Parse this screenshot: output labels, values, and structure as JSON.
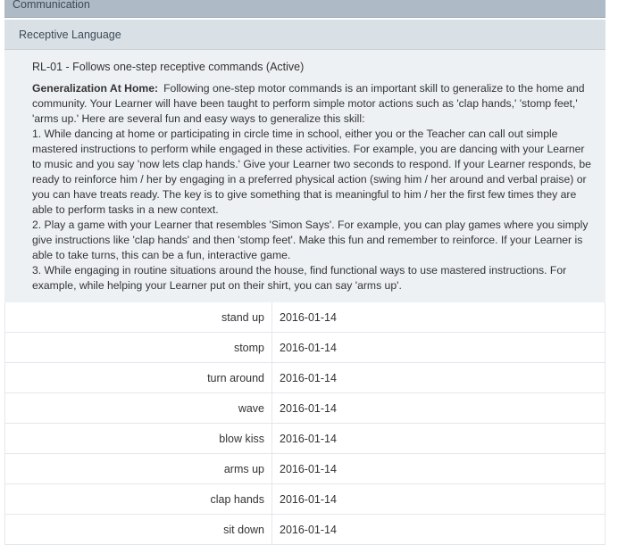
{
  "header": {
    "category": "Communication",
    "subcategory": "Receptive Language"
  },
  "program": {
    "title": "RL-01 - Follows one-step receptive commands (Active)",
    "generalization_label": "Generalization At Home:",
    "generalization_intro": "Following one-step motor commands is an important skill to generalize to the home and community. Your Learner will have been taught to perform simple motor actions such as 'clap hands,' 'stomp feet,' 'arms up.' Here are several fun and easy ways to generalize this skill:",
    "tips": [
      "1. While dancing at home or participating in circle time in school, either you or the Teacher can call out simple mastered instructions to perform while engaged in these activities. For example, you are dancing with your Learner to music and you say 'now lets clap hands.' Give your Learner two seconds to respond. If your Learner responds, be ready to reinforce him / her by engaging in a preferred physical action (swing him / her around and verbal praise) or you can have treats ready. The key is to give something that is meaningful to him / her the first few times they are able to perform tasks in a new context.",
      "2. Play a game with your Learner that resembles 'Simon Says'. For example, you can play games where you simply give instructions like 'clap hands' and then 'stomp feet'. Make this fun and remember to reinforce. If your Learner is able to take turns, this can be a fun, interactive game.",
      "3. While engaging in routine situations around the house, find functional ways to use mastered instructions. For example, while helping your Learner put on their shirt, you can say 'arms up'."
    ]
  },
  "targets": [
    {
      "name": "stand up",
      "date": "2016-01-14"
    },
    {
      "name": "stomp",
      "date": "2016-01-14"
    },
    {
      "name": "turn around",
      "date": "2016-01-14"
    },
    {
      "name": "wave",
      "date": "2016-01-14"
    },
    {
      "name": "blow kiss",
      "date": "2016-01-14"
    },
    {
      "name": "arms up",
      "date": "2016-01-14"
    },
    {
      "name": "clap hands",
      "date": "2016-01-14"
    },
    {
      "name": "sit down",
      "date": "2016-01-14"
    }
  ]
}
